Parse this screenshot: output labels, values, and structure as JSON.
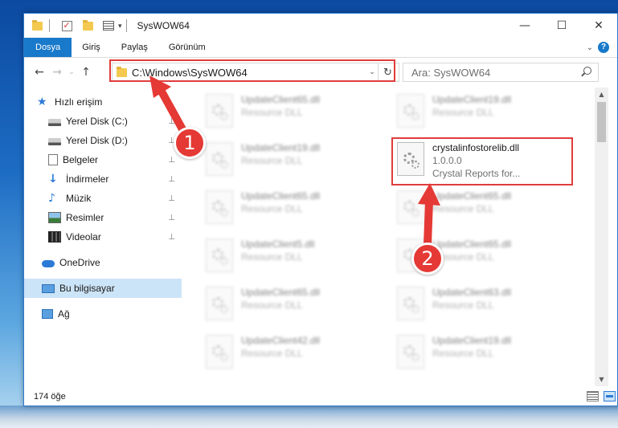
{
  "window": {
    "title": "SysWOW64",
    "controls": {
      "minimize": "—",
      "maximize": "☐",
      "close": "✕"
    }
  },
  "ribbon": {
    "tabs": [
      {
        "label": "Dosya",
        "active": true
      },
      {
        "label": "Giriş",
        "active": false
      },
      {
        "label": "Paylaş",
        "active": false
      },
      {
        "label": "Görünüm",
        "active": false
      }
    ],
    "help": "?"
  },
  "nav": {
    "back": "←",
    "forward": "→",
    "recent": "⌄",
    "up": "↑",
    "address": "C:\\Windows\\SysWOW64",
    "refresh": "↻",
    "search_placeholder": "Ara: SysWOW64"
  },
  "sidebar": {
    "items": [
      {
        "label": "Hızlı erişim",
        "icon": "star-icon",
        "pinned": false
      },
      {
        "label": "Yerel Disk (C:)",
        "icon": "disk-icon",
        "pinned": true
      },
      {
        "label": "Yerel Disk (D:)",
        "icon": "disk-icon",
        "pinned": true
      },
      {
        "label": "Belgeler",
        "icon": "document-icon",
        "pinned": true
      },
      {
        "label": "İndirmeler",
        "icon": "download-icon",
        "pinned": true
      },
      {
        "label": "Müzik",
        "icon": "music-icon",
        "pinned": true
      },
      {
        "label": "Resimler",
        "icon": "pictures-icon",
        "pinned": true
      },
      {
        "label": "Videolar",
        "icon": "videos-icon",
        "pinned": true
      },
      {
        "label": "OneDrive",
        "icon": "cloud-icon",
        "pinned": false
      },
      {
        "label": "Bu bilgisayar",
        "icon": "computer-icon",
        "pinned": false
      },
      {
        "label": "Ağ",
        "icon": "network-icon",
        "pinned": false
      }
    ],
    "pin_glyph": "📌"
  },
  "files": [
    {
      "name": "UpdateClient65.dll",
      "desc": "Resource DLL",
      "blurred": true
    },
    {
      "name": "UpdateClient19.dll",
      "desc": "Resource DLL",
      "blurred": true
    },
    {
      "name": "UpdateClient19.dll",
      "desc": "Resource DLL",
      "blurred": true
    },
    {
      "name": "crystalinfostorelib.dll",
      "version": "1.0.0.0",
      "desc": "Crystal Reports for...",
      "blurred": false
    },
    {
      "name": "UpdateClient65.dll",
      "desc": "Resource DLL",
      "blurred": true
    },
    {
      "name": "UpdateClient65.dll",
      "desc": "Resource DLL",
      "blurred": true
    },
    {
      "name": "UpdateClient5.dll",
      "desc": "Resource DLL",
      "blurred": true
    },
    {
      "name": "UpdateClient65.dll",
      "desc": "Resource DLL",
      "blurred": true
    },
    {
      "name": "UpdateClient65.dll",
      "desc": "Resource DLL",
      "blurred": true
    },
    {
      "name": "UpdateClient63.dll",
      "desc": "Resource DLL",
      "blurred": true
    },
    {
      "name": "UpdateClient42.dll",
      "desc": "Resource DLL",
      "blurred": true
    },
    {
      "name": "UpdateClient19.dll",
      "desc": "Resource DLL",
      "blurred": true
    }
  ],
  "status": {
    "count": "174 öğe"
  },
  "annotations": {
    "badge1": "1",
    "badge2": "2",
    "color": "#e53935"
  },
  "colors": {
    "accent": "#1979ca",
    "selection": "#cce4f7",
    "highlight_box": "#e03c3c"
  }
}
